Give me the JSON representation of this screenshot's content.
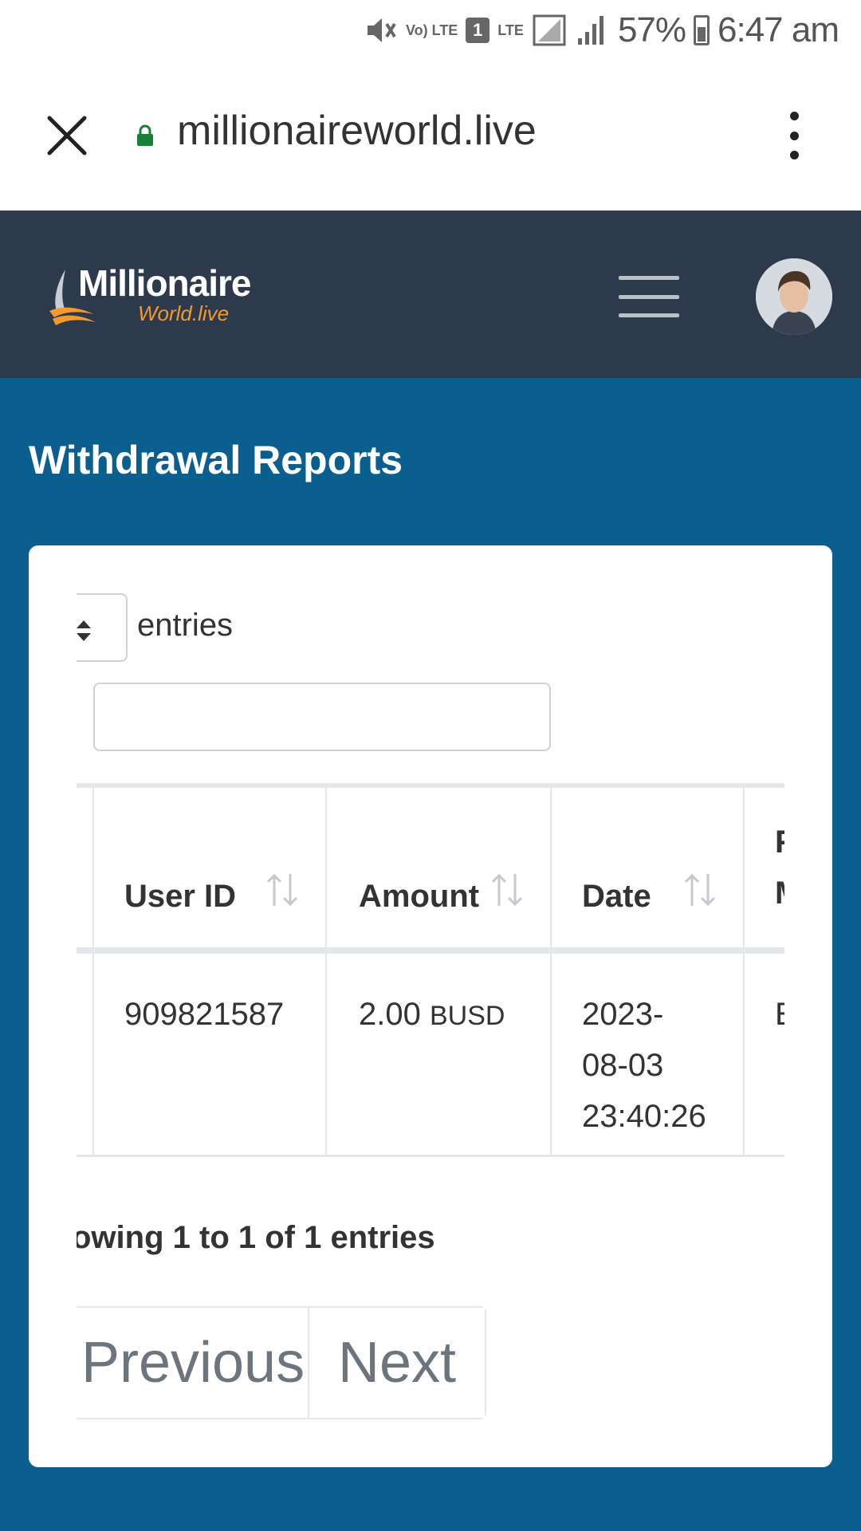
{
  "status_bar": {
    "volte_label": "Vo) LTE",
    "sim_badge": "1",
    "lte_label": "LTE",
    "battery_percent": "57%",
    "time": "6:47 am"
  },
  "browser": {
    "url": "millionaireworld.live"
  },
  "site": {
    "logo_main": "Millionaire",
    "logo_sub": "World.live"
  },
  "page": {
    "title": "Withdrawal Reports"
  },
  "table_controls": {
    "entries_label": "entries",
    "search_value": ""
  },
  "table": {
    "headers": {
      "user_id": "User ID",
      "amount": "Amount",
      "date": "Date",
      "next_col_line1": "F",
      "next_col_line2": "M"
    },
    "rows": [
      {
        "user_id": "909821587",
        "amount": "2.00",
        "currency": "BUSD",
        "date_line1": "2023-",
        "date_line2": "08-03",
        "date_line3": "23:40:26",
        "next_col": "E"
      }
    ]
  },
  "info_text": "owing 1 to 1 of 1 entries",
  "pagination": {
    "previous_label": "Previous",
    "next_label": "Next"
  },
  "colors": {
    "header_bg": "#2c3a4b",
    "page_bg": "#0a5f8e",
    "logo_accent": "#f39a2e"
  }
}
